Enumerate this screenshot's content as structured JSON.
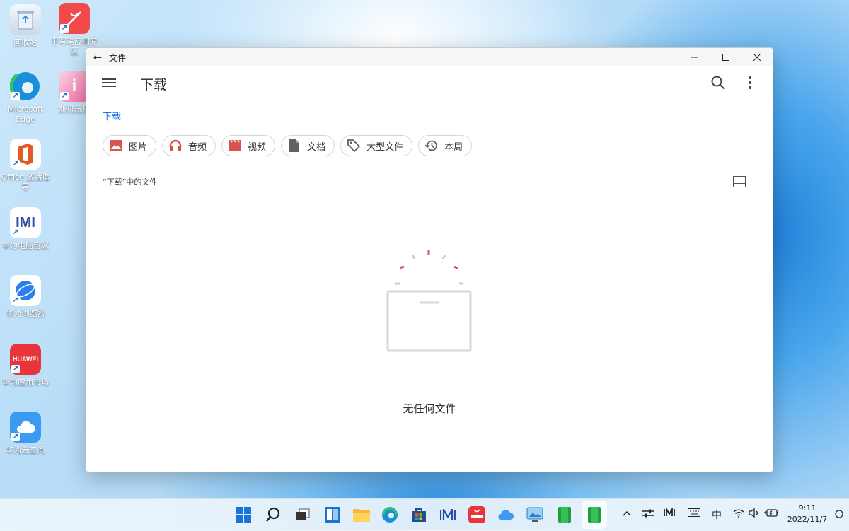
{
  "desktop": {
    "icons": [
      {
        "label": "回收站",
        "color": "#e8f0f8"
      },
      {
        "label": "手写笔应用专区",
        "color": "#f04a4a"
      },
      {
        "label": "Microsoft Edge",
        "color": "#1a8fd9"
      },
      {
        "label": "新机玩机",
        "color": "#f36fa6"
      },
      {
        "label": "Office 激活指导",
        "color": "#e55a24"
      },
      {
        "label": "华为电脑管家",
        "color": "#ffffff"
      },
      {
        "label": "华为浏览器",
        "color": "#2d7ff0"
      },
      {
        "label": "华为应用市场",
        "color": "#e8353b"
      },
      {
        "label": "华为云空间",
        "color": "#3d9af2"
      }
    ],
    "huawei_badge": "HUAWEI"
  },
  "window": {
    "title": "文件",
    "back_icon": "back-arrow-icon",
    "controls": [
      "minimize-icon",
      "maximize-icon",
      "close-icon"
    ]
  },
  "app": {
    "title": "下载",
    "breadcrumb": "下载",
    "chips": [
      {
        "label": "图片",
        "icon": "image-icon",
        "color": "#d9534f"
      },
      {
        "label": "音频",
        "icon": "headphones-icon",
        "color": "#d9534f"
      },
      {
        "label": "视频",
        "icon": "video-icon",
        "color": "#d9534f"
      },
      {
        "label": "文档",
        "icon": "document-icon",
        "color": "#5f6368"
      },
      {
        "label": "大型文件",
        "icon": "tag-icon",
        "color": "#5f6368"
      },
      {
        "label": "本周",
        "icon": "history-icon",
        "color": "#5f6368"
      }
    ],
    "section_label": "“下载”中的文件",
    "empty_text": "无任何文件"
  },
  "taskbar": {
    "input_method": "中",
    "time": "9:11",
    "date": "2022/11/7"
  },
  "colors": {
    "accent": "#1a73e8",
    "chip_accent": "#d9534f"
  }
}
